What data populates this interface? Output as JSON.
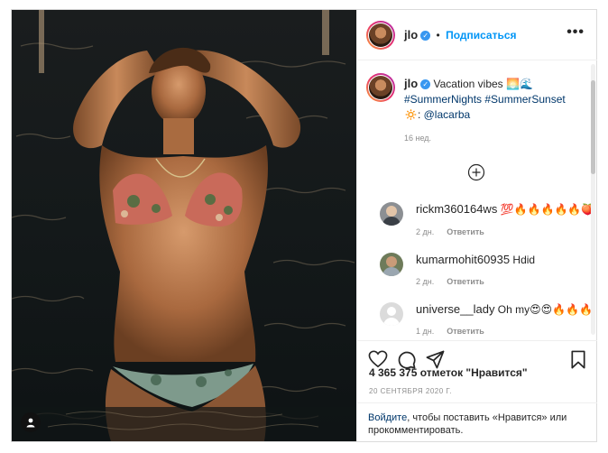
{
  "header": {
    "username": "jlo",
    "follow_label": "Подписаться",
    "separator": "•"
  },
  "caption": {
    "username": "jlo",
    "text": "Vacation vibes 🌅🌊",
    "hashtags": "#SummerNights #SummerSunset",
    "text2": "🔅:",
    "mention": "@lacarba",
    "time": "16 нед."
  },
  "comments": [
    {
      "username": "rickm360164ws",
      "text": "💯🔥🔥🔥🔥🔥🍑",
      "time": "2 дн.",
      "reply_label": "Ответить",
      "avatar_color": "#8c8f93"
    },
    {
      "username": "kumarmohit60935",
      "text": "Hdid",
      "time": "2 дн.",
      "reply_label": "Ответить",
      "avatar_color": "#6e7b5a"
    },
    {
      "username": "universe__lady",
      "text": "Oh my😍😍🔥🔥🔥",
      "time": "1 дн.",
      "reply_label": "Ответить",
      "avatar_color": "#dbdbdb"
    }
  ],
  "likes": "4 365 375 отметок \"Нравится\"",
  "date": "20 СЕНТЯБРЯ 2020 Г.",
  "login_prompt": {
    "link": "Войдите",
    "text": ", чтобы поставить «Нравится» или прокомментировать."
  },
  "icons": {
    "like": "heart-icon",
    "comment": "comment-icon",
    "share": "share-icon",
    "save": "bookmark-icon",
    "more_comments": "plus-circle-icon",
    "options": "more-options-icon",
    "tag": "user-tag-icon"
  },
  "colors": {
    "accent": "#0095f6",
    "verified": "#3897f0",
    "link": "#00376b",
    "muted": "#8e8e8e",
    "border": "#dbdbdb"
  }
}
